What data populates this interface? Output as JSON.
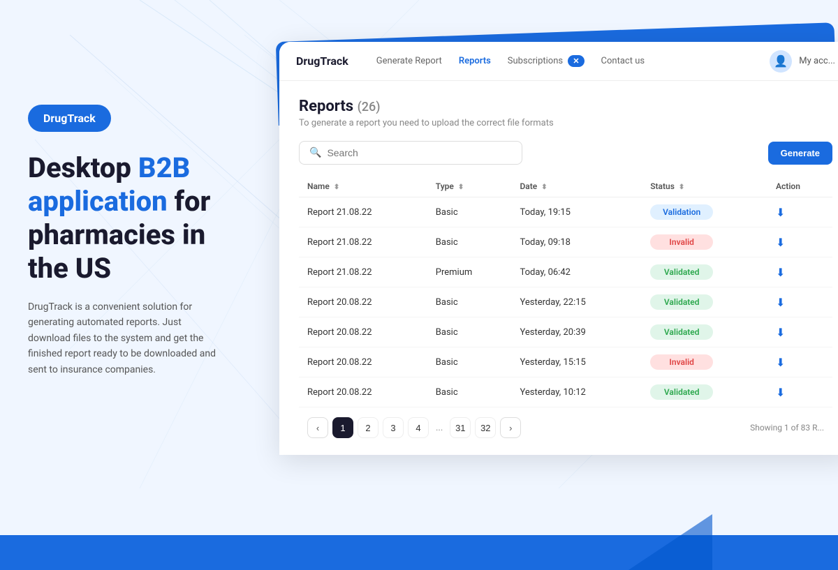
{
  "brand": {
    "name": "DrugTrack"
  },
  "left": {
    "pill_label": "DrugTrack",
    "hero_line1": "Desktop ",
    "hero_blue": "B2B application",
    "hero_line2": " for pharmacies in the US",
    "description": "DrugTrack is a convenient solution for generating automated reports. Just download files to the system and get the finished report ready to be downloaded and sent to insurance companies."
  },
  "nav": {
    "logo": "DrugTrack",
    "links": [
      {
        "label": "Generate Report",
        "active": false
      },
      {
        "label": "Reports",
        "active": true
      },
      {
        "label": "Subscriptions",
        "active": false,
        "badge": "✕"
      },
      {
        "label": "Contact us",
        "active": false
      }
    ],
    "account_label": "My acc...",
    "avatar_icon": "👤"
  },
  "page": {
    "title": "Reports",
    "count": "(26)",
    "subtitle": "To generate a report you need to upload the correct file formats",
    "search_placeholder": "Search",
    "generate_btn": "Generate"
  },
  "table": {
    "columns": [
      {
        "label": "Name",
        "sortable": true
      },
      {
        "label": "Type",
        "sortable": true
      },
      {
        "label": "Date",
        "sortable": true
      },
      {
        "label": "Status",
        "sortable": true
      },
      {
        "label": "Action",
        "sortable": false
      }
    ],
    "rows": [
      {
        "name": "Report 21.08.22",
        "type": "Basic",
        "date": "Today, 19:15",
        "status": "Validation",
        "status_key": "validation"
      },
      {
        "name": "Report 21.08.22",
        "type": "Basic",
        "date": "Today, 09:18",
        "status": "Invalid",
        "status_key": "invalid"
      },
      {
        "name": "Report 21.08.22",
        "type": "Premium",
        "date": "Today, 06:42",
        "status": "Validated",
        "status_key": "validated"
      },
      {
        "name": "Report 20.08.22",
        "type": "Basic",
        "date": "Yesterday, 22:15",
        "status": "Validated",
        "status_key": "validated"
      },
      {
        "name": "Report 20.08.22",
        "type": "Basic",
        "date": "Yesterday, 20:39",
        "status": "Validated",
        "status_key": "validated"
      },
      {
        "name": "Report 20.08.22",
        "type": "Basic",
        "date": "Yesterday, 15:15",
        "status": "Invalid",
        "status_key": "invalid"
      },
      {
        "name": "Report 20.08.22",
        "type": "Basic",
        "date": "Yesterday, 10:12",
        "status": "Validated",
        "status_key": "validated"
      }
    ]
  },
  "pagination": {
    "pages": [
      "1",
      "2",
      "3",
      "4",
      "...",
      "31",
      "32"
    ],
    "current": "1",
    "showing_text": "Showing 1 of 83 R..."
  }
}
